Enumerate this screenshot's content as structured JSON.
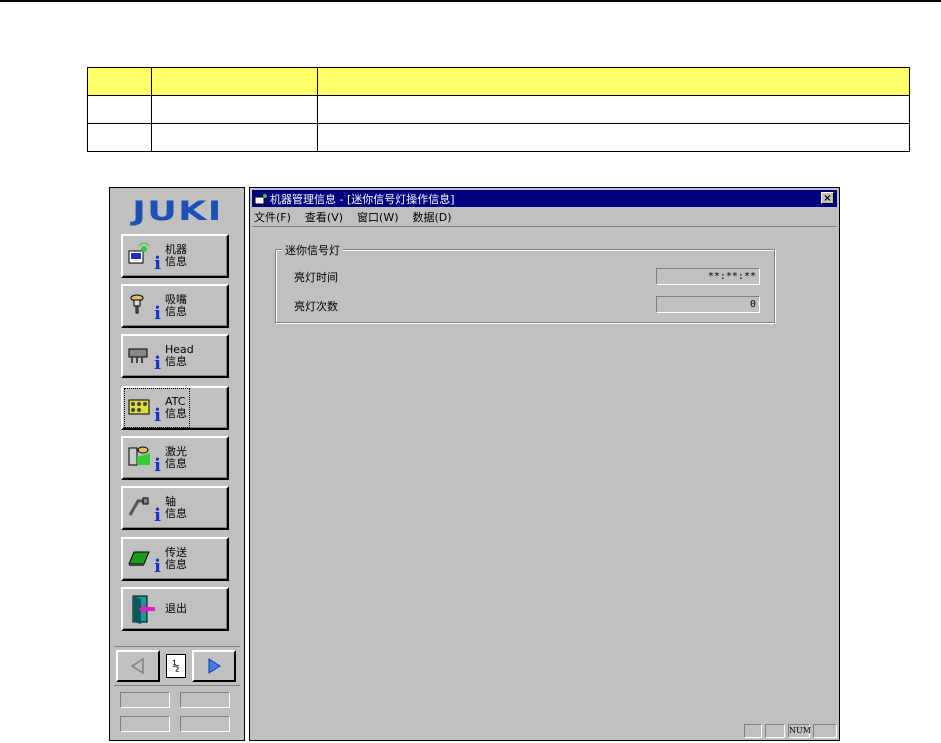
{
  "left_panel": {
    "logo": "JUKI",
    "buttons": [
      {
        "line1": "机器",
        "line2": "信息"
      },
      {
        "line1": "吸嘴",
        "line2": "信息"
      },
      {
        "line1": "Head",
        "line2": "信息"
      },
      {
        "line1": "ATC",
        "line2": "信息"
      },
      {
        "line1": "激光",
        "line2": "信息"
      },
      {
        "line1": "轴",
        "line2": "信息"
      },
      {
        "line1": "传送",
        "line2": "信息"
      },
      {
        "line1": "退出",
        "line2": ""
      }
    ],
    "page_indicator": "½",
    "info_glyph": "i"
  },
  "window": {
    "title": "机器管理信息 - [迷你信号灯操作信息]",
    "close_glyph": "×",
    "menu": [
      "文件(F)",
      "查看(V)",
      "窗口(W)",
      "数据(D)"
    ],
    "group_title": "迷你信号灯",
    "rows": [
      {
        "label": "亮灯时间",
        "value": "**:**:**"
      },
      {
        "label": "亮灯次数",
        "value": "0"
      }
    ],
    "status": {
      "num": "NUM"
    }
  },
  "colors": {
    "header_row": "#ffff66",
    "title_bar": "#000080",
    "face": "#c0c0c0",
    "logo": "#1d4fb5",
    "info": "#1a2fc8"
  }
}
